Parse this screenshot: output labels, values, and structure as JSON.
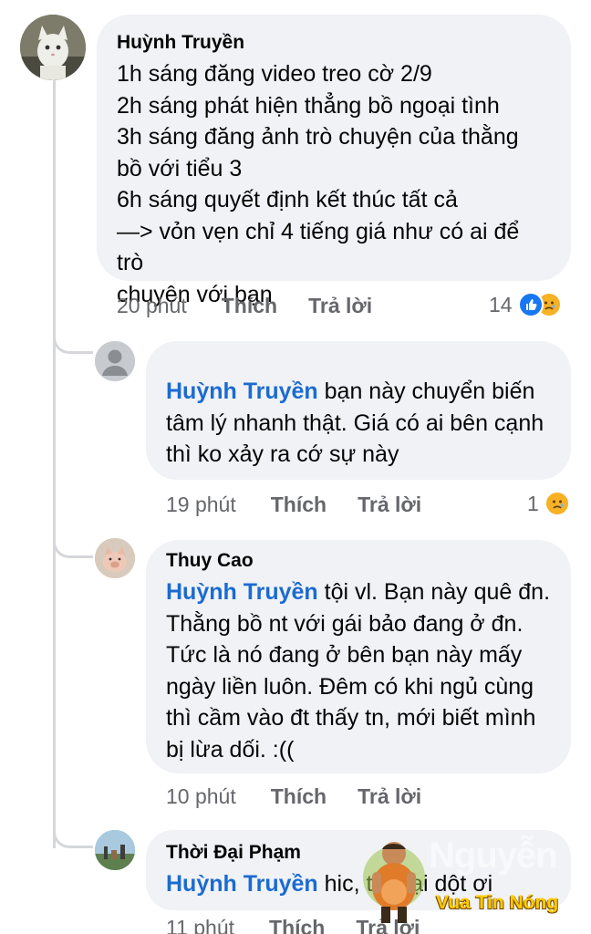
{
  "comments": [
    {
      "author": "Huỳnh Truyền",
      "lines": [
        "1h sáng đăng video treo cờ 2/9",
        "2h sáng phát hiện thẳng bồ ngoại tình",
        "3h sáng đăng ảnh trò chuyện của thằng",
        "bồ với tiểu 3",
        "6h sáng quyết định kết thúc tất cả",
        "—> vỏn vẹn chỉ 4 tiếng giá như có ai để trò",
        "chuyện với bạn"
      ],
      "time": "20 phút",
      "like_label": "Thích",
      "reply_label": "Trả lời",
      "reaction_count": "14",
      "reactions": [
        "like-icon",
        "sad-icon"
      ]
    },
    {
      "author": "",
      "mention": "Huỳnh Truyền",
      "first_line_rest": " bạn này chuyển biến",
      "lines": [
        "tâm lý nhanh thật. Giá có ai bên cạnh",
        "thì ko xảy ra cớ sự này"
      ],
      "time": "19 phút",
      "like_label": "Thích",
      "reply_label": "Trả lời",
      "reaction_count": "1",
      "reactions": [
        "sad-icon"
      ]
    },
    {
      "author": "Thuy Cao",
      "mention": "Huỳnh Truyền",
      "first_line_rest": " tội vl. Bạn này quê đn.",
      "lines": [
        "Thằng bồ nt với gái bảo đang ở đn.",
        "Tức là nó đang ở bên bạn này mấy",
        "ngày liền luôn. Đêm có khi ngủ cùng",
        "thì cầm vào đt thấy tn, mới biết mình",
        "bị lừa dối. :(("
      ],
      "time": "10 phút",
      "like_label": "Thích",
      "reply_label": "Trả lời"
    },
    {
      "author": "Thời Đại Phạm",
      "mention": "Huỳnh Truyền",
      "first_line_rest": " hic, t      ại dột ơi",
      "time": "11 phút",
      "like_label": "Thích",
      "reply_label": "Trả lời"
    }
  ],
  "watermark": {
    "big_text": "Nguyễn",
    "text": "Vua Tin Nóng"
  },
  "colors": {
    "bubble": "#f0f2f5",
    "mention": "#1b6bd1",
    "meta": "#65676b",
    "like": "#1877f2",
    "sad": "#f7b125"
  }
}
